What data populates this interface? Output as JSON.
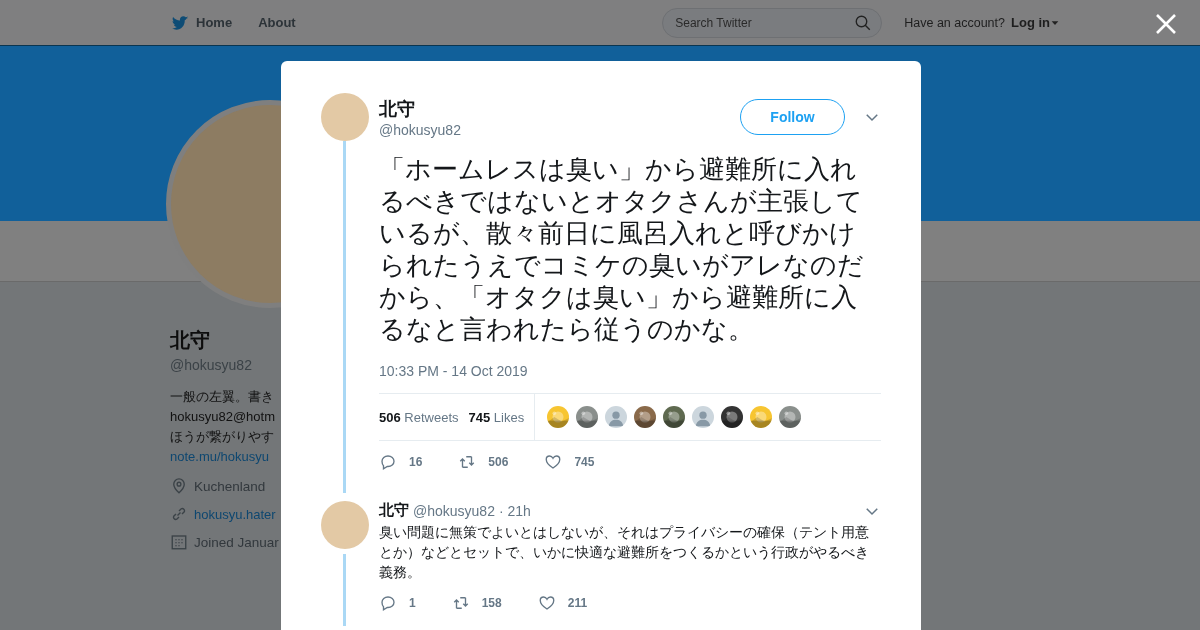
{
  "topbar": {
    "nav": [
      {
        "label": "Home",
        "kind": "home"
      },
      {
        "label": "About",
        "kind": "plain"
      }
    ],
    "search": {
      "placeholder": "Search Twitter"
    },
    "account_prompt": "Have an account?",
    "login": "Log in"
  },
  "profile": {
    "name": "北守",
    "handle": "@hokusyu82",
    "bio_lines": [
      "一般の左翼。書き",
      "hokusyu82@hotm",
      "ほうが繋がりやす"
    ],
    "bio_link": "note.mu/hokusyu",
    "location": "Kuchenland",
    "website": "hokusyu.hater",
    "joined": "Joined Januar"
  },
  "tweet": {
    "name": "北守",
    "handle": "@hokusyu82",
    "follow": "Follow",
    "text": "「ホームレスは臭い」から避難所に入れるべきではないとオタクさんが主張しているが、散々前日に風呂入れと呼びかけられたうえでコミケの臭いがアレなのだから、「オタクは臭い」から避難所に入るなと言われたら従うのかな。",
    "timestamp": "10:33 PM - 14 Oct 2019",
    "stats": [
      {
        "count": "506",
        "label": "Retweets"
      },
      {
        "count": "745",
        "label": "Likes"
      }
    ],
    "likers": [
      {
        "kind": "picture"
      },
      {
        "kind": "picture"
      },
      {
        "kind": "default"
      },
      {
        "kind": "picture"
      },
      {
        "kind": "picture"
      },
      {
        "kind": "default"
      },
      {
        "kind": "picture"
      },
      {
        "kind": "picture"
      },
      {
        "kind": "picture"
      }
    ],
    "actions": {
      "reply": "16",
      "retweet": "506",
      "like": "745"
    }
  },
  "replies": [
    {
      "name": "北守",
      "handle": "@hokusyu82",
      "time": "· 21h",
      "text": "臭い問題に無策でよいとはしないが、それはプライバシーの確保（テント用意とか）などとセットで、いかに快適な避難所をつくるかという行政がやるべき義務。",
      "actions": {
        "reply": "1",
        "retweet": "158",
        "like": "211"
      }
    }
  ]
}
